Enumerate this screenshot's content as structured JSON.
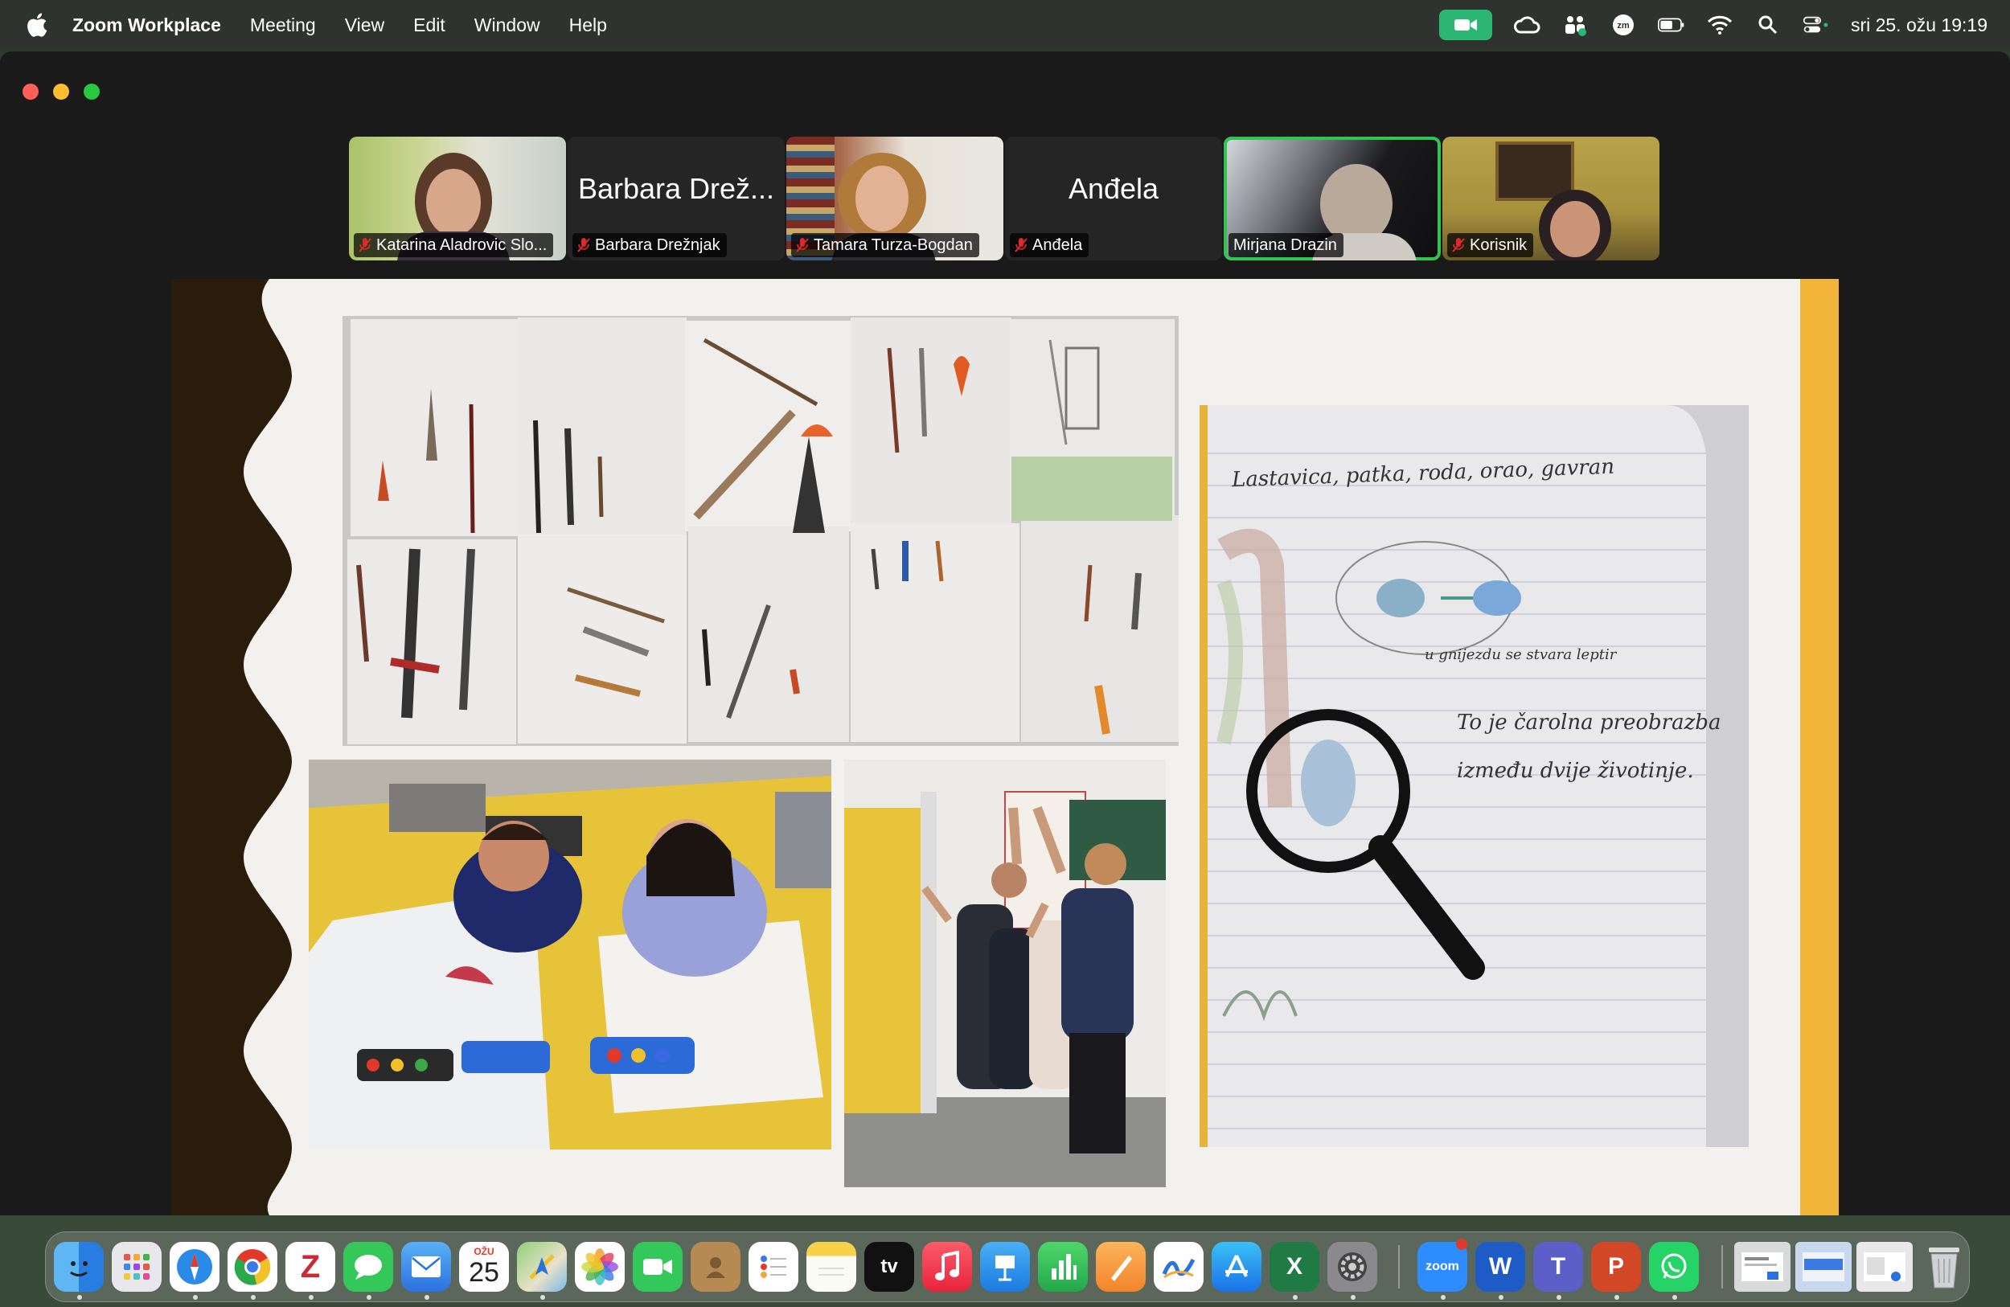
{
  "menubar": {
    "app_name": "Zoom Workplace",
    "menus": [
      "Meeting",
      "View",
      "Edit",
      "Window",
      "Help"
    ],
    "status_icons": [
      "zoom-camera-icon",
      "creative-cloud-icon",
      "teams-status-icon",
      "zoom-status-icon",
      "battery-icon",
      "wifi-icon",
      "spotlight-search-icon",
      "control-center-icon"
    ],
    "clock": "sri 25. ožu  19:19"
  },
  "participants": [
    {
      "label": "Katarina Aladrovic Slo...",
      "muted": true,
      "video": true
    },
    {
      "label": "Barbara Drežnjak",
      "big_name": "Barbara Drež...",
      "muted": true,
      "video": false
    },
    {
      "label": "Tamara Turza-Bogdan",
      "muted": true,
      "video": true
    },
    {
      "label": "Anđela",
      "big_name": "Anđela",
      "muted": true,
      "video": false
    },
    {
      "label": "Mirjana Drazin",
      "muted": false,
      "video": true,
      "active_speaker": true
    },
    {
      "label": "Korisnik",
      "muted": true,
      "video": true
    }
  ],
  "slide": {
    "notebook_text": [
      "Lastavica, patka, roda, orao, gavran",
      "u gnijezdu se stvara leptir",
      "To je čarolna preobrazba",
      "između dvije životinje."
    ]
  },
  "dock": {
    "calendar_month": "OŽU",
    "calendar_day": "25",
    "apps": [
      "finder",
      "launchpad",
      "safari",
      "chrome",
      "zotero",
      "messages",
      "mail",
      "calendar",
      "maps",
      "photos",
      "facetime",
      "contacts",
      "reminders",
      "notes",
      "apple-tv",
      "music",
      "keynote",
      "numbers",
      "pages",
      "freeform",
      "app-store",
      "excel",
      "system-settings",
      "zoom",
      "word",
      "teams",
      "powerpoint",
      "whatsapp"
    ],
    "zoom_label": "zoom",
    "tv_label": "tv",
    "word_label": "W",
    "excel_label": "X",
    "ppt_label": "P",
    "teams_label": "T"
  },
  "colors": {
    "active_speaker": "#31c453",
    "slide_yellow": "#f2b53a",
    "zoom_green": "#2bb673"
  }
}
